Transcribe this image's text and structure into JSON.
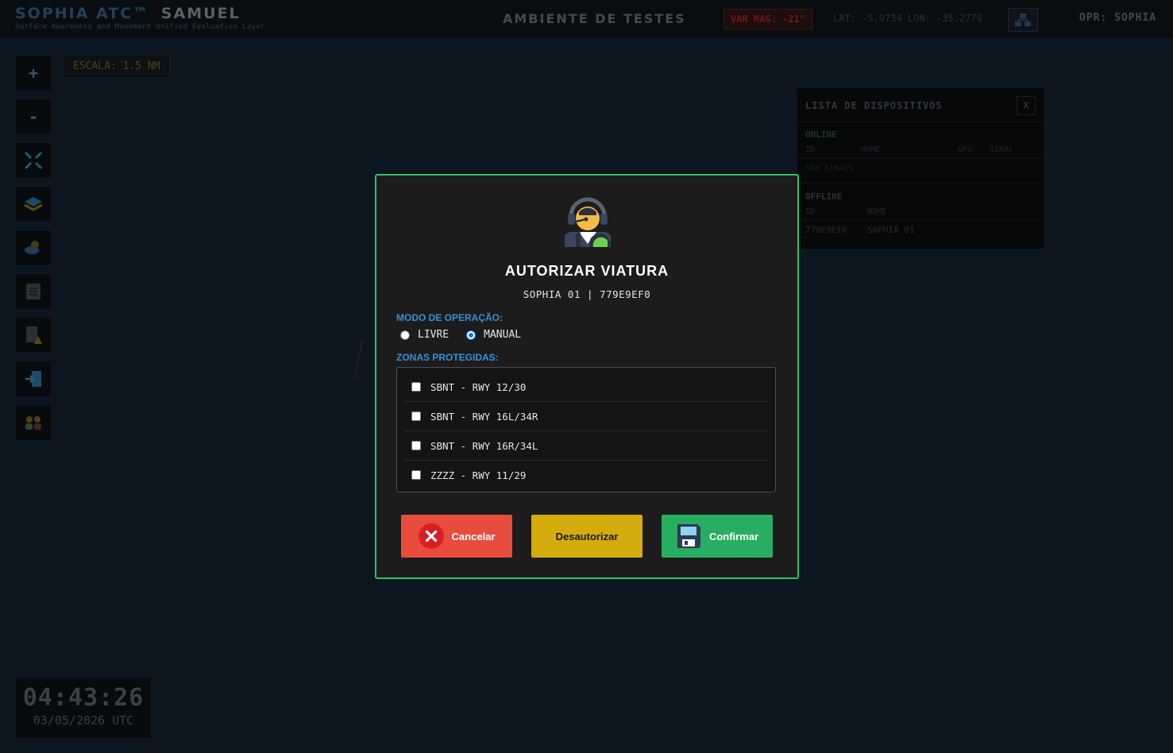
{
  "header": {
    "app_title": "SOPHIA ATC™",
    "user_name": "SAMUEL",
    "subtitle": "Surface Awareness and Movement Unified Evaluation Layer",
    "environment": "AMBIENTE DE TESTES",
    "var_mag": "VAR MAG: -21°",
    "coordinates": "LAT: -5.9734 LON: -35.2776",
    "operator": "OPR: SOPHIA"
  },
  "toolbar": {
    "zoom_in": "+",
    "zoom_out": "-"
  },
  "map": {
    "scale": "ESCALA: 1.5 NM"
  },
  "device_list": {
    "title": "LISTA DE DISPOSITIVOS",
    "close": "X",
    "online_label": "ONLINE",
    "online_columns": [
      "ID",
      "NOME",
      "GPS",
      "SINAL"
    ],
    "online_empty": "SEM SINAIS",
    "offline_label": "OFFLINE",
    "offline_columns": [
      "ID",
      "NOME"
    ],
    "offline_rows": [
      {
        "id": "779E9EF0",
        "name": "SOPHIA 01"
      }
    ]
  },
  "clock": {
    "time": "04:43:26",
    "date": "03/05/2026 UTC"
  },
  "modal": {
    "title": "AUTORIZAR VIATURA",
    "subtitle": "SOPHIA 01 | 779E9EF0",
    "mode_label": "MODO DE OPERAÇÃO:",
    "modes": [
      {
        "label": "LIVRE",
        "checked": false
      },
      {
        "label": "MANUAL",
        "checked": true
      }
    ],
    "zones_label": "ZONAS PROTEGIDAS:",
    "zones": [
      {
        "label": "SBNT - RWY 12/30",
        "checked": false
      },
      {
        "label": "SBNT - RWY 16L/34R",
        "checked": false
      },
      {
        "label": "SBNT - RWY 16R/34L",
        "checked": false
      },
      {
        "label": "ZZZZ - RWY 11/29",
        "checked": false
      }
    ],
    "buttons": {
      "cancel": "Cancelar",
      "unauthorize": "Desautorizar",
      "confirm": "Confirmar"
    }
  },
  "icons": {
    "avatar": "operator-headset-icon",
    "cancel": "close-circle-icon",
    "confirm": "floppy-disk-icon"
  },
  "colors": {
    "modal_border": "#2fc06b",
    "section_label": "#3a8fd6",
    "cancel": "#e74c3c",
    "unauthorize": "#d4ac0d",
    "confirm": "#27ae60"
  }
}
